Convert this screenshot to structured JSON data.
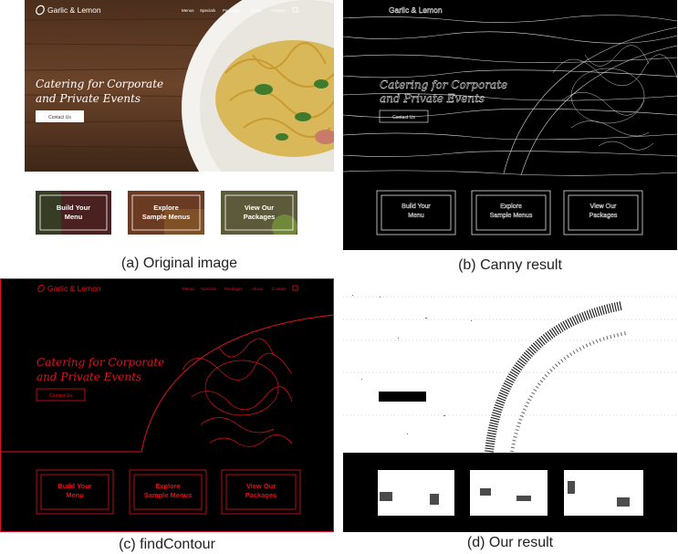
{
  "site": {
    "brand": "Garlic & Lemon",
    "nav": [
      "Menus",
      "Specials",
      "Packages",
      "About",
      "Contact"
    ],
    "headline_line1": "Catering for Corporate",
    "headline_line2": "and Private Events",
    "cta": "Contact Us",
    "tiles": [
      {
        "line1": "Build Your",
        "line2": "Menu"
      },
      {
        "line1": "Explore",
        "line2": "Sample Menus"
      },
      {
        "line1": "View Our",
        "line2": "Packages"
      }
    ]
  },
  "captions": {
    "a": "(a) Original image",
    "b": "(b) Canny result",
    "c": "(c) findContour",
    "d": "(d) Our result"
  },
  "colors": {
    "wood": "#5a3a24",
    "contour": "#e0101c",
    "canny": "#ffffff"
  }
}
